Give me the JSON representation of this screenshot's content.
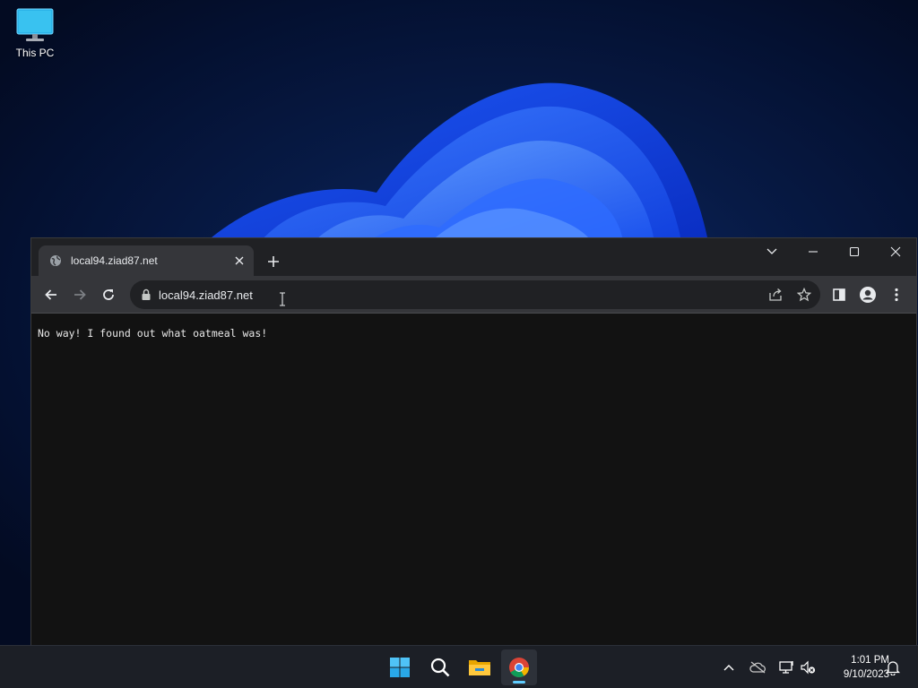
{
  "desktop": {
    "icons": [
      {
        "label": "This PC",
        "icon": "monitor-icon"
      }
    ]
  },
  "browser": {
    "tabs": [
      {
        "title": "local94.ziad87.net",
        "icon": "globe-icon",
        "active": true
      }
    ],
    "address_bar": {
      "url": "local94.ziad87.net",
      "secure_icon": "lock-icon"
    },
    "page": {
      "text": "No way! I found out what oatmeal was!"
    }
  },
  "taskbar": {
    "apps": [
      {
        "name": "start",
        "icon": "windows-logo-icon"
      },
      {
        "name": "search",
        "icon": "search-icon"
      },
      {
        "name": "file-explorer",
        "icon": "folder-icon"
      },
      {
        "name": "chrome",
        "icon": "chrome-icon",
        "active": true
      }
    ],
    "clock": {
      "time": "1:01 PM",
      "date": "9/10/2023"
    }
  },
  "colors": {
    "accent": "#60cdff",
    "browser_frame": "#202124",
    "toolbar": "#35363a",
    "page_bg": "#121212"
  }
}
